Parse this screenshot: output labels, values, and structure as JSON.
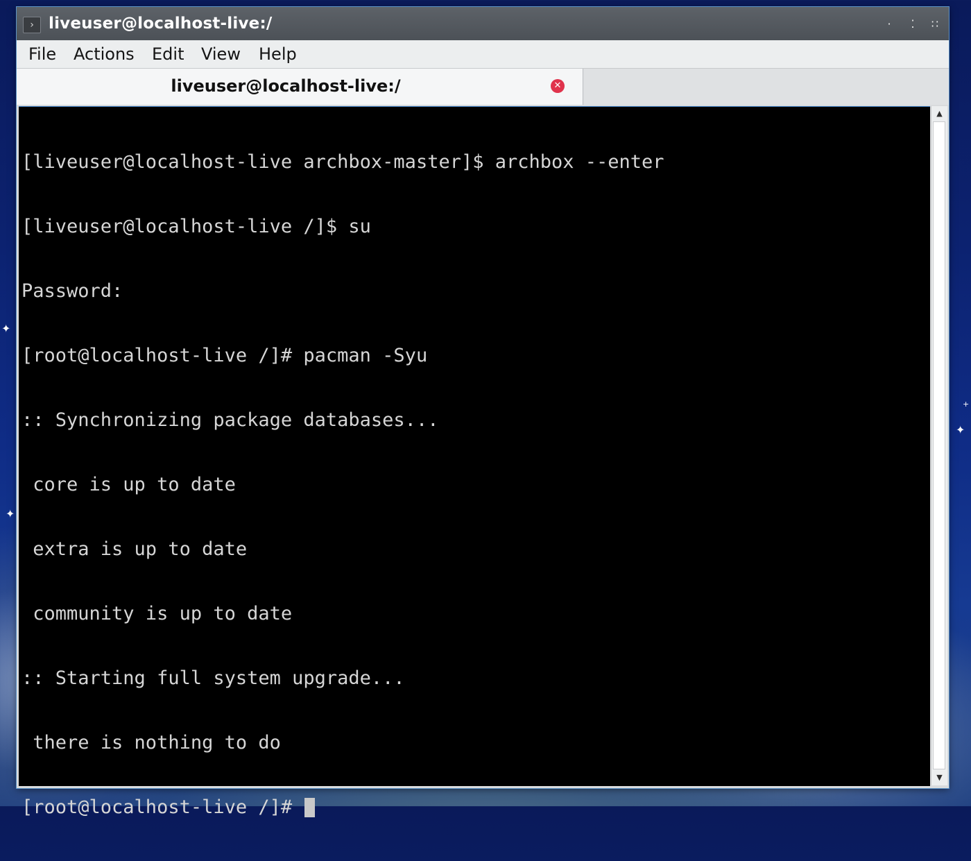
{
  "window": {
    "title": "liveuser@localhost-live:/",
    "app_icon": "terminal-prompt-icon",
    "controls": [
      "minimize-icon",
      "maximize-icon",
      "close-icon"
    ]
  },
  "menubar": {
    "items": [
      "File",
      "Actions",
      "Edit",
      "View",
      "Help"
    ]
  },
  "tabs": [
    {
      "label": "liveuser@localhost-live:/",
      "active": true,
      "close_icon": "close-icon",
      "close_color": "#e0334c"
    }
  ],
  "terminal": {
    "background": "#000000",
    "foreground": "#d6d6d6",
    "lines": [
      "[liveuser@localhost-live archbox-master]$ archbox --enter",
      "[liveuser@localhost-live /]$ su",
      "Password:",
      "[root@localhost-live /]# pacman -Syu",
      ":: Synchronizing package databases...",
      " core is up to date",
      " extra is up to date",
      " community is up to date",
      ":: Starting full system upgrade...",
      " there is nothing to do",
      "[root@localhost-live /]# "
    ],
    "cursor": "block-cursor"
  },
  "scrollbar": {
    "up_icon": "arrow-up-icon",
    "down_icon": "arrow-down-icon"
  },
  "colors": {
    "titlebar": "#4c5157",
    "accent_border": "#5b93c7",
    "menubar": "#eceeef"
  }
}
